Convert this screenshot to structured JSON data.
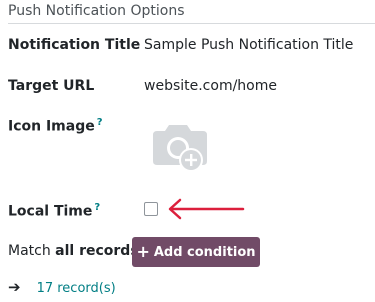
{
  "section": {
    "title": "Push Notification Options"
  },
  "fields": {
    "notification_title": {
      "label": "Notification Title",
      "value": "Sample Push Notification Title"
    },
    "target_url": {
      "label": "Target URL",
      "value": "website.com/home"
    },
    "icon_image": {
      "label": "Icon Image",
      "help": "?",
      "icon": "camera-add-icon"
    },
    "local_time": {
      "label": "Local Time",
      "help": "?",
      "checked": false
    }
  },
  "domain": {
    "match_prefix": "Match",
    "match_scope": "all records",
    "add_condition": {
      "plus": "+",
      "label": "Add condition"
    },
    "records_arrow": "➔",
    "records_link": "17 record(s)"
  },
  "colors": {
    "accent": "#714b67",
    "link": "#017e84",
    "annotation_arrow": "#dc1f3c"
  }
}
